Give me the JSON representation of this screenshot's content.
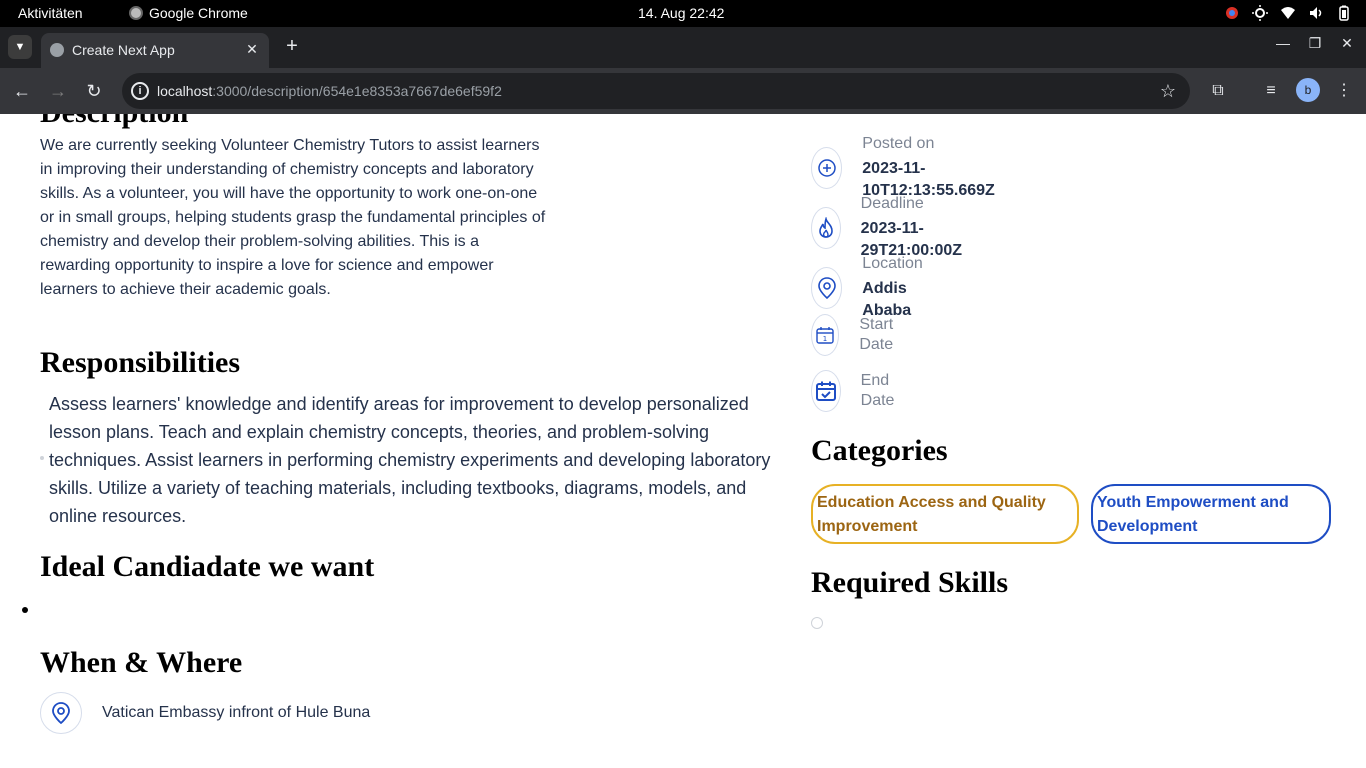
{
  "system_bar": {
    "activities": "Aktivitäten",
    "app_name": "Google Chrome",
    "clock": "14. Aug  22:42"
  },
  "browser": {
    "tab_title": "Create Next App",
    "url_host": "localhost",
    "url_rest": ":3000/description/654e1e8353a7667de6ef59f2",
    "profile_initial": "b"
  },
  "page": {
    "description": "We are currently seeking Volunteer Chemistry Tutors to assist learners in improving their understanding of chemistry concepts and laboratory skills. As a volunteer, you will have the opportunity to work one-on-one or in small groups, helping students grasp the fundamental principles of chemistry and develop their problem-solving abilities. This is a rewarding opportunity to inspire a love for science and empower learners to achieve their academic goals.",
    "responsibilities_heading": "Responsibilities",
    "responsibilities_text": "Assess learners' knowledge and identify areas for improvement to develop personalized lesson plans. Teach and explain chemistry concepts, theories, and problem-solving techniques. Assist learners in performing chemistry experiments and developing laboratory skills. Utilize a variety of teaching materials, including textbooks, diagrams, models, and online resources.",
    "ideal_candidate_heading": "Ideal Candiadate we want",
    "when_where_heading": "When & Where",
    "when_where_location": "Vatican Embassy infront of Hule Buna",
    "info": {
      "posted_label": "Posted on",
      "posted_value": "2023-11-10T12:13:55.669Z",
      "deadline_label": "Deadline",
      "deadline_value": "2023-11-29T21:00:00Z",
      "location_label": "Location",
      "location_value": "Addis Ababa",
      "start_label": "Start Date",
      "end_label": "End Date"
    },
    "categories_heading": "Categories",
    "categories": [
      "Education Access and Quality Improvement",
      "Youth Empowerment and Development"
    ],
    "required_skills_heading": "Required Skills"
  },
  "colors": {
    "accent_blue": "#1E4DC4",
    "chip_yellow_border": "#E7B125",
    "chip_yellow_text": "#9C6512",
    "text_dark": "#25324B",
    "text_muted": "#7C8493"
  }
}
